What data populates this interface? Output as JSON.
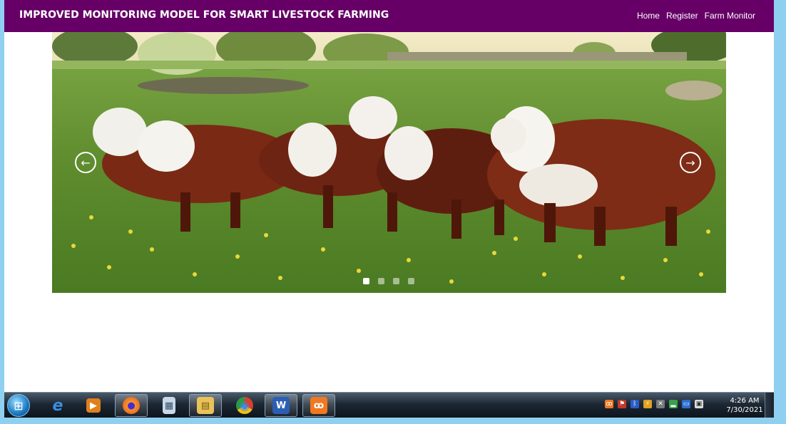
{
  "navbar": {
    "brand": "IMPROVED MONITORING MODEL FOR SMART LIVESTOCK FARMING",
    "links": [
      "Home",
      "Register",
      "Farm Monitor"
    ],
    "color": "#660066"
  },
  "carousel": {
    "prev_icon": "arrow-left-icon",
    "next_icon": "arrow-right-icon",
    "prev_glyph": "←",
    "next_glyph": "→",
    "slide_count": 4,
    "active_slide": 1
  },
  "taskbar": {
    "start_icon": "windows-start-icon",
    "apps": [
      {
        "name": "internet-explorer-icon",
        "glyph": "e",
        "color": "#1e73c8"
      },
      {
        "name": "media-player-icon",
        "glyph": "▶",
        "color": "#e0801c"
      },
      {
        "name": "firefox-icon",
        "glyph": "●",
        "color": "#e86a12"
      },
      {
        "name": "calculator-icon",
        "glyph": "▦",
        "color": "#9fb8d0"
      },
      {
        "name": "file-explorer-icon",
        "glyph": "▤",
        "color": "#e8c35a"
      },
      {
        "name": "chrome-icon",
        "glyph": "◉",
        "color": "#d8402c"
      },
      {
        "name": "word-icon",
        "glyph": "W",
        "color": "#2b5fb3"
      },
      {
        "name": "xampp-icon",
        "glyph": "ꝏ",
        "color": "#f07820"
      }
    ],
    "clock_time": "4:26 AM",
    "clock_date": "7/30/2021"
  }
}
